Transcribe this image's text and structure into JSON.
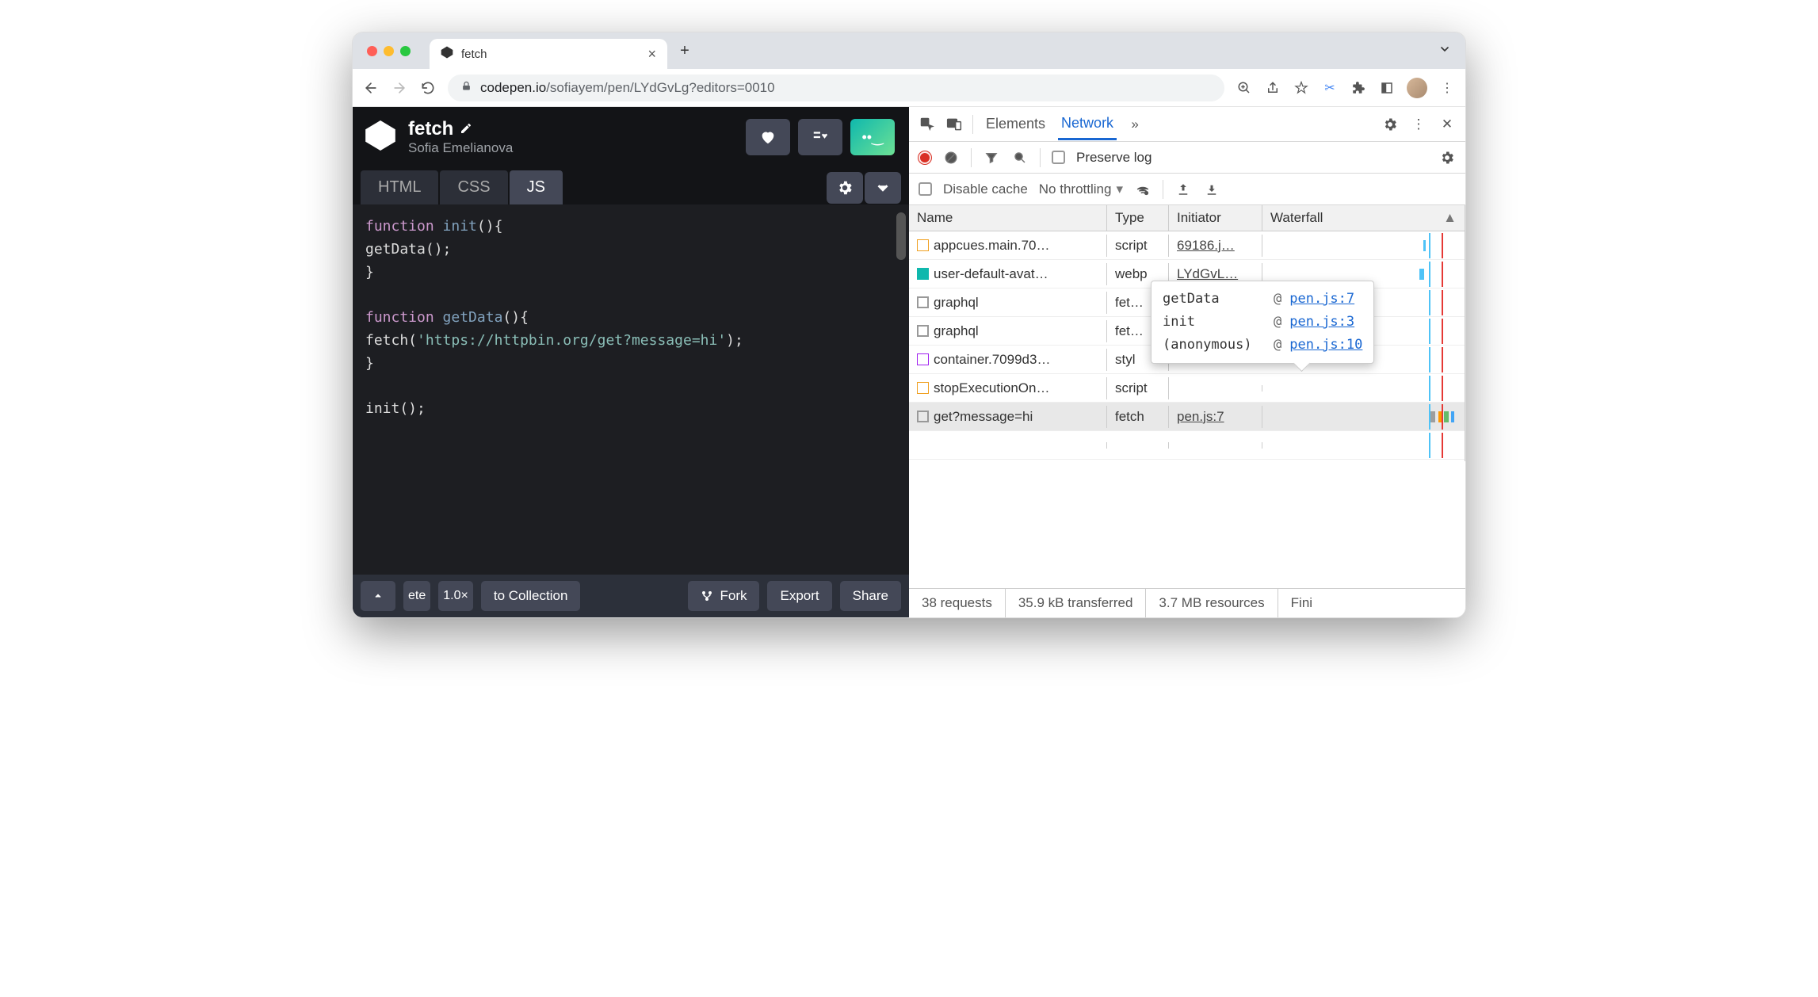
{
  "browser": {
    "tab_title": "fetch",
    "url_host": "codepen.io",
    "url_path": "/sofiayem/pen/LYdGvLg?editors=0010"
  },
  "codepen": {
    "title": "fetch",
    "author": "Sofia Emelianova",
    "tabs": {
      "html": "HTML",
      "css": "CSS",
      "js": "JS"
    },
    "code_lines": [
      [
        {
          "cls": "kw",
          "t": "function"
        },
        {
          "cls": "",
          "t": " "
        },
        {
          "cls": "fn",
          "t": "init"
        },
        {
          "cls": "",
          "t": "(){"
        }
      ],
      [
        {
          "cls": "",
          "t": "  getData();"
        }
      ],
      [
        {
          "cls": "",
          "t": "}"
        }
      ],
      [],
      [
        {
          "cls": "kw",
          "t": "function"
        },
        {
          "cls": "",
          "t": " "
        },
        {
          "cls": "fn",
          "t": "getData"
        },
        {
          "cls": "",
          "t": "(){"
        }
      ],
      [
        {
          "cls": "",
          "t": "  fetch("
        },
        {
          "cls": "str",
          "t": "'https://httpbin.org/get?message=hi'"
        },
        {
          "cls": "",
          "t": ");"
        }
      ],
      [
        {
          "cls": "",
          "t": "}"
        }
      ],
      [],
      [
        {
          "cls": "",
          "t": "init();"
        }
      ]
    ],
    "footer": {
      "zoom": "1.0×",
      "delete_fragment": "ete",
      "to_collection": "to Collection",
      "fork": "Fork",
      "export": "Export",
      "share": "Share"
    }
  },
  "devtools": {
    "panels": {
      "elements": "Elements",
      "network": "Network"
    },
    "toolbar": {
      "preserve_log": "Preserve log",
      "disable_cache": "Disable cache",
      "no_throttling": "No throttling"
    },
    "headers": {
      "name": "Name",
      "type": "Type",
      "initiator": "Initiator",
      "waterfall": "Waterfall"
    },
    "rows": [
      {
        "icon": "js",
        "name": "appcues.main.70…",
        "type": "script",
        "initiator": "69186.j…",
        "selected": false
      },
      {
        "icon": "webp",
        "name": "user-default-avat…",
        "type": "webp",
        "initiator": "LYdGvL…",
        "selected": false
      },
      {
        "icon": "box",
        "name": "graphql",
        "type": "fet…",
        "initiator": "",
        "selected": false
      },
      {
        "icon": "box",
        "name": "graphql",
        "type": "fet…",
        "initiator": "",
        "selected": false
      },
      {
        "icon": "purple",
        "name": "container.7099d3…",
        "type": "styl",
        "initiator": "",
        "selected": false
      },
      {
        "icon": "js",
        "name": "stopExecutionOn…",
        "type": "script",
        "initiator": "",
        "selected": false
      },
      {
        "icon": "box",
        "name": "get?message=hi",
        "type": "fetch",
        "initiator": "pen.js:7",
        "selected": true
      }
    ],
    "tooltip": [
      {
        "fn": "getData",
        "loc": "pen.js:7"
      },
      {
        "fn": "init",
        "loc": "pen.js:3"
      },
      {
        "fn": "(anonymous)",
        "loc": "pen.js:10"
      }
    ],
    "status": {
      "requests": "38 requests",
      "transferred": "35.9 kB transferred",
      "resources": "3.7 MB resources",
      "finish": "Fini"
    }
  }
}
